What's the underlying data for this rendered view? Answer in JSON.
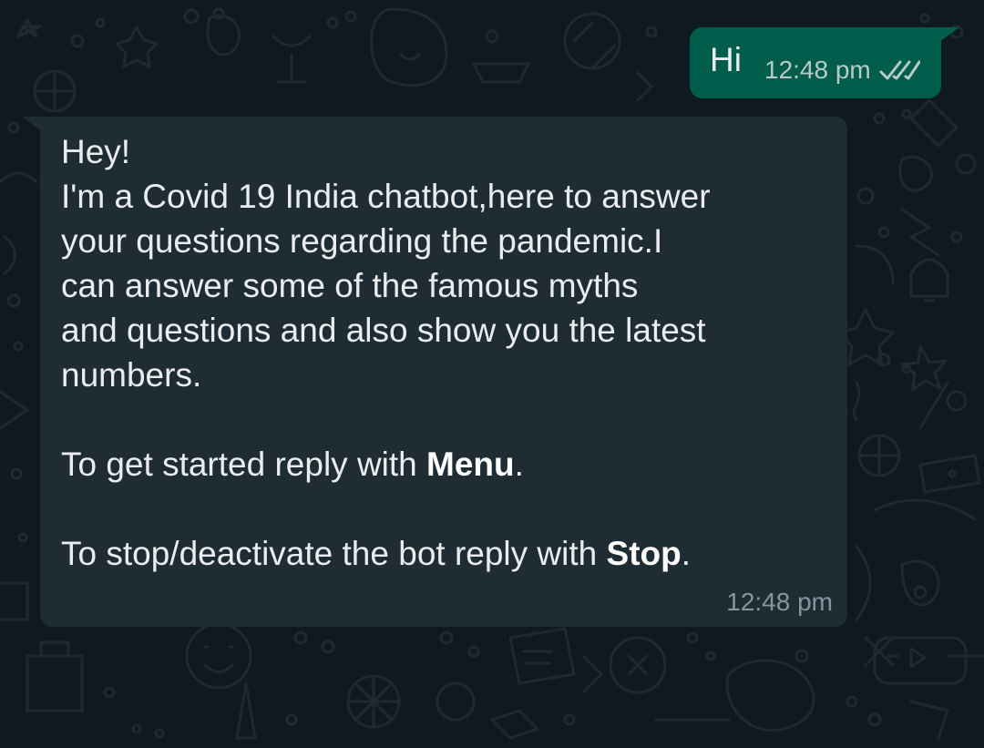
{
  "chat": {
    "outgoing": {
      "text": "Hi",
      "time": "12:48 pm",
      "status_icon": "double-check-icon"
    },
    "incoming": {
      "lines": [
        "Hey!",
        "I'm a Covid 19 India chatbot,here to answer",
        "your questions regarding the pandemic.I",
        "can answer some of the famous myths",
        "and questions and also show you the latest",
        "numbers."
      ],
      "menu_prefix": "To get started reply with ",
      "menu_keyword": "Menu",
      "menu_suffix": ".",
      "stop_prefix": "To stop/deactivate the bot reply with ",
      "stop_keyword": "Stop",
      "stop_suffix": ".",
      "time": "12:48 pm"
    }
  },
  "colors": {
    "background": "#0f1a20",
    "outgoing_bubble": "#005c4b",
    "incoming_bubble": "#202c33",
    "text_primary": "#e9edef",
    "timestamp_incoming": "#8696a0",
    "timestamp_outgoing": "#b5ccc6"
  }
}
